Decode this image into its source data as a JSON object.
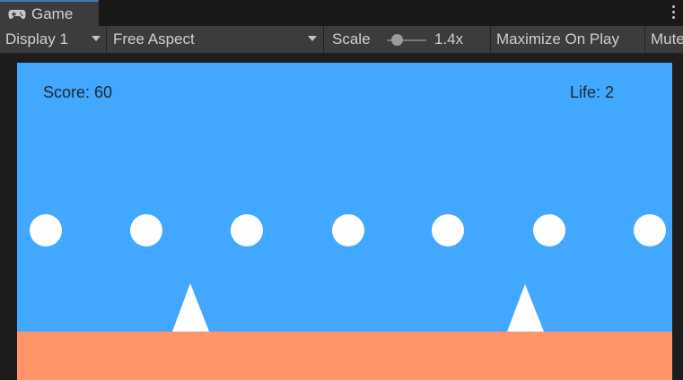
{
  "tab": {
    "title": "Game",
    "icon": "gamepad-icon"
  },
  "toolbar": {
    "display": "Display 1",
    "aspect": "Free Aspect",
    "scale_label": "Scale",
    "scale_value": "1.4x",
    "maximize": "Maximize On Play",
    "mute": "Mute"
  },
  "game": {
    "score_text": "Score: 60",
    "life_text": "Life: 2",
    "colors": {
      "sky": "#42a7ff",
      "ground": "#ff9466",
      "orb": "#ffffff",
      "spike": "#ffffff",
      "hud_text": "#1e2a33"
    },
    "orb_count": 7,
    "spike_count": 2
  }
}
